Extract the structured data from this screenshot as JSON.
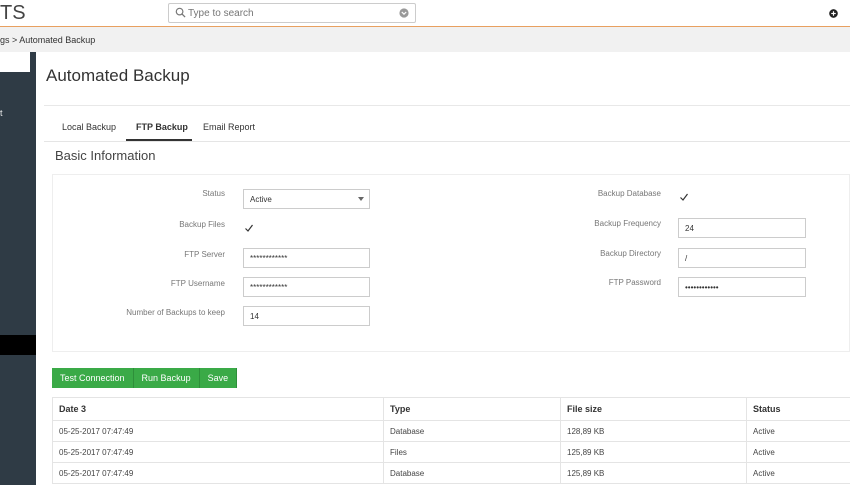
{
  "header": {
    "logo_text": "TS",
    "search_placeholder": "Type to search"
  },
  "breadcrumb": {
    "text": "gs > Automated Backup"
  },
  "sidebar": {
    "fragment_text": "t"
  },
  "page": {
    "title": "Automated Backup"
  },
  "tabs": [
    {
      "label": "Local Backup",
      "active": false
    },
    {
      "label": "FTP Backup",
      "active": true
    },
    {
      "label": "Email Report",
      "active": false
    }
  ],
  "section": {
    "title": "Basic Information"
  },
  "form": {
    "status_label": "Status",
    "status_value": "Active",
    "backup_files_label": "Backup Files",
    "backup_files_checked": true,
    "ftp_server_label": "FTP Server",
    "ftp_server_value": "************",
    "ftp_username_label": "FTP Username",
    "ftp_username_value": "************",
    "num_backups_label": "Number of Backups to keep",
    "num_backups_value": "14",
    "backup_database_label": "Backup Database",
    "backup_database_checked": true,
    "backup_frequency_label": "Backup Frequency",
    "backup_frequency_value": "24",
    "backup_directory_label": "Backup Directory",
    "backup_directory_value": "/",
    "ftp_password_label": "FTP Password",
    "ftp_password_value": "••••••••••••"
  },
  "buttons": {
    "test_connection": "Test Connection",
    "run_backup": "Run Backup",
    "save": "Save",
    "color": "#3aaa47"
  },
  "table": {
    "headers": [
      "Date 3",
      "Type",
      "File size",
      "Status"
    ],
    "rows": [
      [
        "05-25-2017 07:47:49",
        "Database",
        "128,89 KB",
        "Active"
      ],
      [
        "05-25-2017 07:47:49",
        "Files",
        "125,89 KB",
        "Active"
      ],
      [
        "05-25-2017 07:47:49",
        "Database",
        "125,89 KB",
        "Active"
      ]
    ]
  }
}
